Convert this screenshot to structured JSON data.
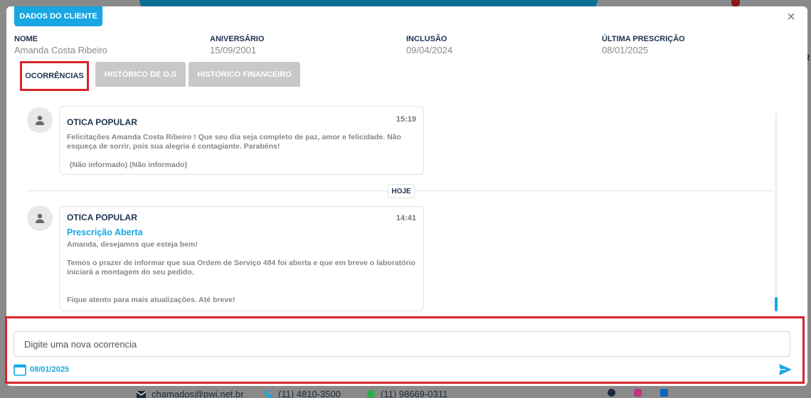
{
  "background": {
    "footer": {
      "email": "chamados@pwi.net.br",
      "phone": "(11) 4810-3500",
      "whatsapp": "(11) 98669-0311"
    },
    "right_edge_letter": "R"
  },
  "modal": {
    "header_tag": "DADOS DO CLIENTE",
    "close_icon": "×",
    "info": [
      {
        "label": "NOME",
        "value": "Amanda Costa Ribeiro"
      },
      {
        "label": "ANIVERSÁRIO",
        "value": "15/09/2001"
      },
      {
        "label": "INCLUSÃO",
        "value": "09/04/2024"
      },
      {
        "label": "ÚLTIMA PRESCRIÇÃO",
        "value": "08/01/2025"
      }
    ],
    "tabs": [
      {
        "label": "OCORRÊNCIAS",
        "active": true
      },
      {
        "label": "HISTÓRICO DE O.S",
        "active": false
      },
      {
        "label": "HISTÓRICO FINANCEIRO",
        "active": false
      }
    ],
    "messages": [
      {
        "sender": "OTICA POPULAR",
        "time": "15:19",
        "text": "Felicitações Amanda Costa Ribeiro ! Que seu dia seja completo de paz, amor e felicidade. Não esqueça de sorrir, pois sua alegria é contagiante. Parabéns!",
        "footer": "(Não informado) (Não informado)"
      },
      {
        "sender": "OTICA POPULAR",
        "time": "14:41",
        "title": "Prescrição Aberta",
        "text": "Amanda, desejamos que esteja bem!",
        "text2": "Temos o prazer de informar que sua Ordem de Serviço 484 foi aberta e que em breve o laboratório iniciará a montagem do seu pedido.",
        "text3": "Fique atento para mais atualizações. Até breve!"
      }
    ],
    "day_divider": "HOJE",
    "composer": {
      "placeholder": "Digite uma nova ocorrencia",
      "date": "08/01/2025"
    }
  },
  "colors": {
    "accent": "#17a7e3",
    "navy": "#1e3350",
    "highlight": "#d9242b"
  }
}
